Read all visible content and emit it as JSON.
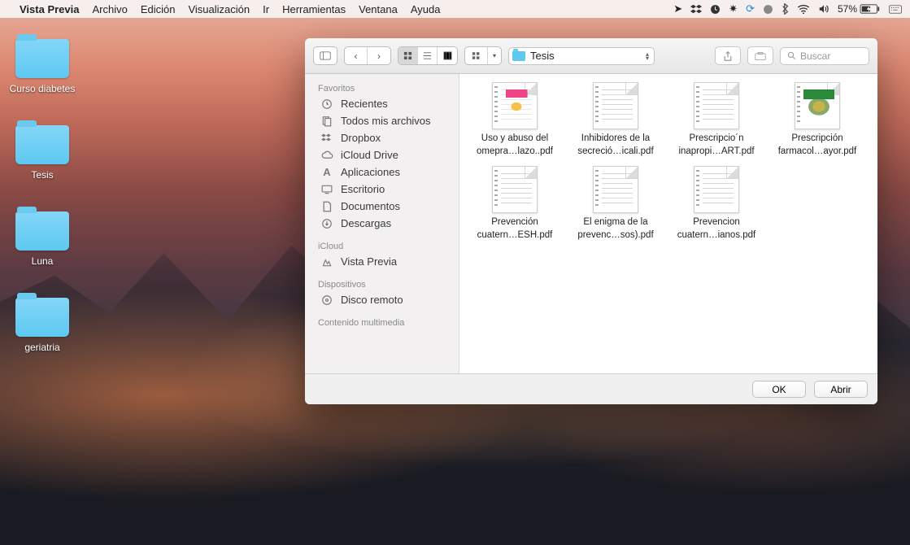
{
  "menubar": {
    "app": "Vista Previa",
    "items": [
      "Archivo",
      "Edición",
      "Visualización",
      "Ir",
      "Herramientas",
      "Ventana",
      "Ayuda"
    ],
    "battery": "57%",
    "clock": ""
  },
  "desktop_icons": [
    {
      "label": "Curso diabetes"
    },
    {
      "label": "Tesis"
    },
    {
      "label": "Luna"
    },
    {
      "label": "geriatria"
    }
  ],
  "finder": {
    "path_label": "Tesis",
    "search_placeholder": "Buscar",
    "sidebar": {
      "favorites_head": "Favoritos",
      "favorites": [
        {
          "icon": "clock",
          "label": "Recientes"
        },
        {
          "icon": "doc",
          "label": "Todos mis archivos"
        },
        {
          "icon": "dropbox",
          "label": "Dropbox"
        },
        {
          "icon": "cloud",
          "label": "iCloud Drive"
        },
        {
          "icon": "apps",
          "label": "Aplicaciones"
        },
        {
          "icon": "desktop",
          "label": "Escritorio"
        },
        {
          "icon": "docfolder",
          "label": "Documentos"
        },
        {
          "icon": "download",
          "label": "Descargas"
        }
      ],
      "icloud_head": "iCloud",
      "icloud": [
        {
          "icon": "preview",
          "label": "Vista Previa"
        }
      ],
      "devices_head": "Dispositivos",
      "devices": [
        {
          "icon": "disc",
          "label": "Disco remoto"
        }
      ],
      "media_head": "Contenido multimedia"
    },
    "files": [
      {
        "style": "color",
        "line1": "Uso y abuso del",
        "line2": "omepra…lazo..pdf"
      },
      {
        "style": "plain",
        "line1": "Inhibidores de la",
        "line2": "secreció…icali.pdf"
      },
      {
        "style": "plain",
        "line1": "Prescripcio´n",
        "line2": "inapropi…ART.pdf"
      },
      {
        "style": "green",
        "line1": "Prescripción",
        "line2": "farmacol…ayor.pdf"
      },
      {
        "style": "plain",
        "line1": "Prevención",
        "line2": "cuatern…ESH.pdf"
      },
      {
        "style": "plain",
        "line1": "El enigma de la",
        "line2": "prevenc…sos).pdf"
      },
      {
        "style": "plain",
        "line1": "Prevencion",
        "line2": "cuatern…ianos.pdf"
      }
    ],
    "footer": {
      "ok": "OK",
      "open": "Abrir"
    }
  }
}
